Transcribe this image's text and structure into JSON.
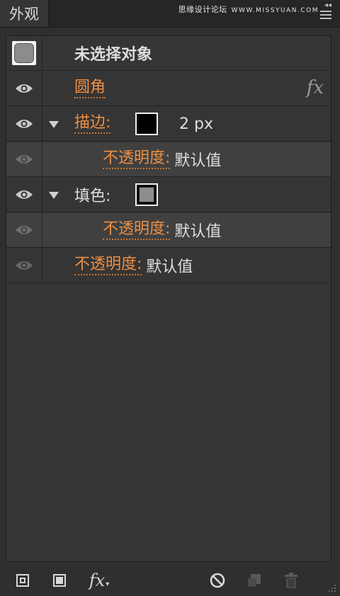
{
  "panel": {
    "tab_label": "外观",
    "watermark": "思缘设计论坛",
    "watermark_url": "WWW.MISSYUAN.COM",
    "collapse_glyph": "◂◂"
  },
  "header_row": {
    "label": "未选择对象"
  },
  "rows": [
    {
      "label": "圆角",
      "fx_label": "fx"
    },
    {
      "label": "描边:",
      "value": "2 px",
      "swatch": "black"
    },
    {
      "label": "不透明度:",
      "value": "默认值"
    },
    {
      "label": "填色:",
      "swatch": "gray"
    },
    {
      "label": "不透明度:",
      "value": "默认值"
    },
    {
      "label": "不透明度:",
      "value": "默认值"
    }
  ],
  "toolbar": {
    "fx_label": "fx",
    "fx_caret": "▾",
    "icons": [
      "add-stroke-icon",
      "add-fill-icon",
      "fx-menu-icon",
      "clear-appearance-icon",
      "duplicate-item-icon",
      "delete-item-icon"
    ]
  },
  "colors": {
    "accent": "#ef8f42",
    "panel_bg": "#353535",
    "sub_row_bg": "#404040"
  }
}
